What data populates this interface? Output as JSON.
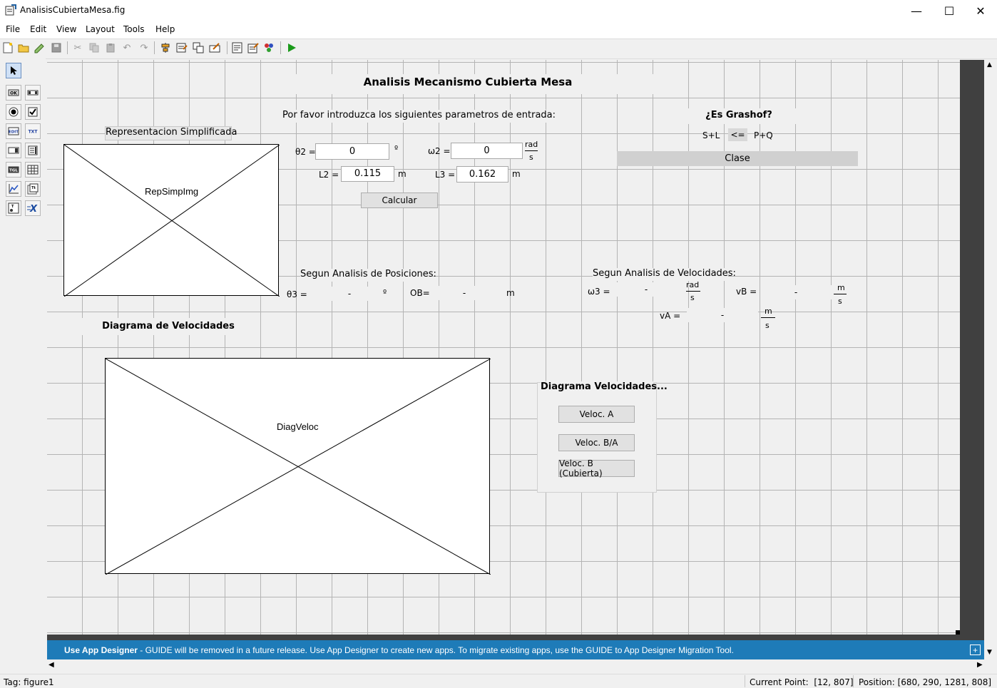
{
  "window": {
    "title": "AnalisisCubiertaMesa.fig",
    "minimize": "—",
    "maximize": "☐",
    "close": "✕"
  },
  "menu": [
    "File",
    "Edit",
    "View",
    "Layout",
    "Tools",
    "Help"
  ],
  "toolbar_icons": [
    "new-file-icon",
    "open-folder-icon",
    "edit-icon",
    "save-icon",
    "cut-icon",
    "copy-icon",
    "paste-icon",
    "undo-icon",
    "redo-icon",
    "align-icon",
    "menu-editor-icon",
    "tab-order-icon",
    "toolbar-editor-icon",
    "editor-icon",
    "property-inspector-icon",
    "object-browser-icon",
    "run-icon"
  ],
  "palette_icons": [
    "select-arrow-icon",
    "push-button-icon",
    "slider-icon",
    "radio-button-icon",
    "checkbox-icon",
    "edit-text-icon",
    "static-text-icon",
    "popup-menu-icon",
    "listbox-icon",
    "toggle-button-icon",
    "table-icon",
    "axes-icon",
    "panel-icon",
    "button-group-icon",
    "activex-icon"
  ],
  "figure": {
    "title": "Analisis Mecanismo Cubierta Mesa",
    "prompt": "Por favor introduzca los siguientes parametros de entrada:",
    "rep_label": "Representacion Simplificada",
    "rep_axes_tag": "RepSimpImg",
    "theta2_label": "θ2 =",
    "theta2_value": "0",
    "theta2_unit": "º",
    "w2_label": "ω2 =",
    "w2_value": "0",
    "w2_unit_num": "rad",
    "w2_unit_den": "s",
    "L2_label": "L2 =",
    "L2_value": "0.115",
    "L2_unit": "m",
    "L3_label": "L3 =",
    "L3_value": "0.162",
    "L3_unit": "m",
    "calc_button": "Calcular",
    "grashof_title": "¿Es Grashof?",
    "grashof_left": "S+L",
    "grashof_op": "<=",
    "grashof_right": "P+Q",
    "grashof_class": "Clase",
    "pos_title": "Segun Analisis de Posiciones:",
    "theta3_label": "θ3 =",
    "theta3_value": "-",
    "theta3_unit": "º",
    "OB_label": "OB=",
    "OB_value": "-",
    "OB_unit": "m",
    "vel_title": "Segun Analisis de Velocidades:",
    "w3_label": "ω3 =",
    "w3_value": "-",
    "w3_unit_num": "rad",
    "w3_unit_den": "s",
    "vB_label": "vB =",
    "vB_value": "-",
    "vB_unit_num": "m",
    "vB_unit_den": "s",
    "vA_label": "vA =",
    "vA_value": "-",
    "vA_unit_num": "m",
    "vA_unit_den": "s",
    "diag_title": "Diagrama de Velocidades",
    "diag_axes_tag": "DiagVeloc",
    "panel_title": "Diagrama Velocidades...",
    "btn_velA": "Veloc. A",
    "btn_velBA": "Veloc. B/A",
    "btn_velB": "Veloc. B (Cubierta)"
  },
  "banner": {
    "bold": "Use App Designer",
    "text": " - GUIDE will be removed in a future release. Use App Designer to create new apps. To migrate existing apps, use the GUIDE to App Designer Migration Tool.",
    "expand": "+"
  },
  "status": {
    "tag": "Tag: figure1",
    "current_point": "Current Point:  [12, 807]",
    "position": "Position: [680, 290, 1281, 808]"
  },
  "colors": {
    "banner": "#1e7bb8",
    "canvas": "#f0f0f0",
    "grid": "#b4b4b4",
    "run_green": "#1a9a1a"
  }
}
